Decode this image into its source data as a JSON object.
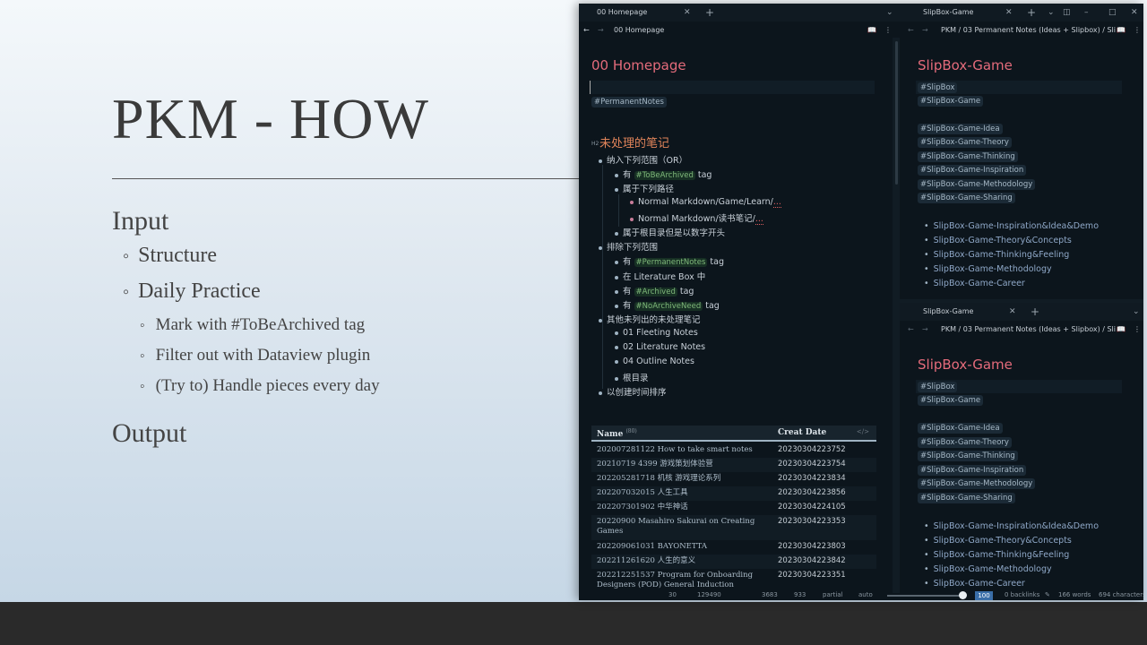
{
  "slide": {
    "title": "PKM - HOW",
    "input_heading": "Input",
    "structure": "Structure",
    "daily_practice": "Daily Practice",
    "sub_items": [
      "Mark with #ToBeArchived tag",
      "Filter out with Dataview plugin",
      "(Try to) Handle pieces every day"
    ],
    "output_heading": "Output"
  },
  "left_pane": {
    "tab_label": "00 Homepage",
    "breadcrumb": "00 Homepage",
    "note_title": "00 Homepage",
    "tag_permanent": "#PermanentNotes",
    "h2_marker": "H2",
    "h2_title": "未处理的笔记",
    "list": {
      "include": "纳入下列范围（OR）",
      "has": "有",
      "tag_word": "tag",
      "tag_tobearchived": "#ToBeArchived",
      "belongs_paths": "属于下列路径",
      "path1": "Normal Markdown/Game/Learn/",
      "path2": "Normal Markdown/读书笔记/",
      "ellipsis": "...",
      "root_digit": "属于根目录但是以数字开头",
      "exclude": "排除下列范围",
      "tag_permanent": "#PermanentNotes",
      "in_litbox": "在 Literature Box 中",
      "tag_archived": "#Archived",
      "tag_noarchive": "#NoArchiveNeed",
      "other_unlisted": "其他未列出的未处理笔记",
      "fleeting": "01 Fleeting Notes",
      "literature": "02 Literature Notes",
      "outline": "04 Outline Notes",
      "root_dir": "根目录",
      "sort_by_created": "以创建时间排序"
    },
    "dataview": {
      "col_name": "Name",
      "count": "(80)",
      "col_date": "Creat Date",
      "code_icon": "</>",
      "rows": [
        {
          "name": "202007281122 How to take smart notes",
          "date": "20230304223752"
        },
        {
          "name": "20210719 4399 游戏策划体验营",
          "date": "20230304223754"
        },
        {
          "name": "202205281718 机核 游戏理论系列",
          "date": "20230304223834"
        },
        {
          "name": "202207032015 人生工具",
          "date": "20230304223856"
        },
        {
          "name": "202207301902 中华神话",
          "date": "20230304224105"
        },
        {
          "name": "20220900 Masahiro Sakurai on Creating Games",
          "date": "20230304223353"
        },
        {
          "name": "202209061031 BAYONETTA",
          "date": "20230304223803"
        },
        {
          "name": "202211261620 人生的意义",
          "date": "20230304223842"
        },
        {
          "name": "202212251537 Program for Onboarding Designers (POD) General Induction",
          "date": "20230304223351"
        }
      ]
    }
  },
  "right_pane": {
    "tab_label": "SlipBox-Game",
    "breadcrumb": "PKM / 03 Permanent Notes (Ideas + Slipbox) / Sli",
    "note_title": "SlipBox-Game",
    "tags_top": [
      "#SlipBox",
      "#SlipBox-Game"
    ],
    "tags_sub": [
      "#SlipBox-Game-Idea",
      "#SlipBox-Game-Theory",
      "#SlipBox-Game-Thinking",
      "#SlipBox-Game-Inspiration",
      "#SlipBox-Game-Methodology",
      "#SlipBox-Game-Sharing"
    ],
    "links": [
      "SlipBox-Game-Inspiration&Idea&Demo",
      "SlipBox-Game-Theory&Concepts",
      "SlipBox-Game-Thinking&Feeling",
      "SlipBox-Game-Methodology",
      "SlipBox-Game-Career"
    ]
  },
  "status": {
    "segment1": "30",
    "segment2": "129490",
    "segment3": "3683",
    "segment4": "933",
    "partial": "partial",
    "auto": "auto",
    "zoom": "100",
    "backlinks": "0 backlinks",
    "words": "166 words",
    "characters": "694 characters"
  }
}
